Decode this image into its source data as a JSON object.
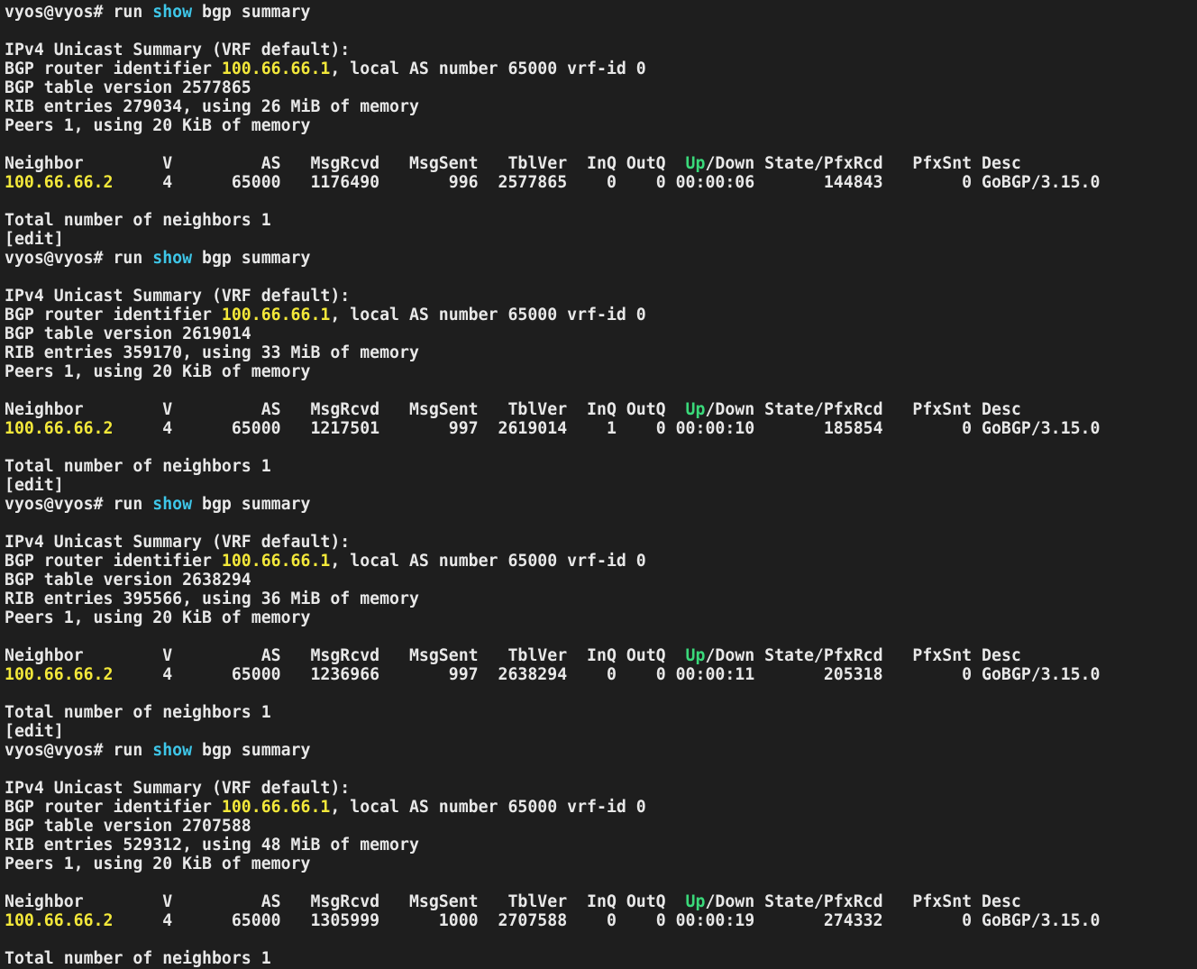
{
  "theme": {
    "background": "#1e1e1e",
    "foreground": "#e8e8e8",
    "command_keyword": "#3ec6e8",
    "ip_address": "#f3e83a",
    "up_status": "#3ad97a"
  },
  "lines": [
    [
      {
        "t": "vyos@vyos# run "
      },
      {
        "t": "show",
        "c": "show"
      },
      {
        "t": " bgp summary"
      }
    ],
    [],
    [
      {
        "t": "IPv4 Unicast Summary (VRF default):"
      }
    ],
    [
      {
        "t": "BGP router identifier "
      },
      {
        "t": "100.66.66.1",
        "c": "ip"
      },
      {
        "t": ", local AS number 65000 vrf-id 0"
      }
    ],
    [
      {
        "t": "BGP table version 2577865"
      }
    ],
    [
      {
        "t": "RIB entries 279034, using 26 MiB of memory"
      }
    ],
    [
      {
        "t": "Peers 1, using 20 KiB of memory"
      }
    ],
    [],
    [
      {
        "t": "Neighbor        V         AS   MsgRcvd   MsgSent   TblVer  InQ OutQ  "
      },
      {
        "t": "Up",
        "c": "up"
      },
      {
        "t": "/Down State/PfxRcd   PfxSnt Desc"
      }
    ],
    [
      {
        "t": "100.66.66.2",
        "c": "ip"
      },
      {
        "t": "     4      65000   1176490       996  2577865    0    0 00:00:06       144843        0 GoBGP/3.15.0"
      }
    ],
    [],
    [
      {
        "t": "Total number of neighbors 1"
      }
    ],
    [
      {
        "t": "[edit]"
      }
    ],
    [
      {
        "t": "vyos@vyos# run "
      },
      {
        "t": "show",
        "c": "show"
      },
      {
        "t": " bgp summary"
      }
    ],
    [],
    [
      {
        "t": "IPv4 Unicast Summary (VRF default):"
      }
    ],
    [
      {
        "t": "BGP router identifier "
      },
      {
        "t": "100.66.66.1",
        "c": "ip"
      },
      {
        "t": ", local AS number 65000 vrf-id 0"
      }
    ],
    [
      {
        "t": "BGP table version 2619014"
      }
    ],
    [
      {
        "t": "RIB entries 359170, using 33 MiB of memory"
      }
    ],
    [
      {
        "t": "Peers 1, using 20 KiB of memory"
      }
    ],
    [],
    [
      {
        "t": "Neighbor        V         AS   MsgRcvd   MsgSent   TblVer  InQ OutQ  "
      },
      {
        "t": "Up",
        "c": "up"
      },
      {
        "t": "/Down State/PfxRcd   PfxSnt Desc"
      }
    ],
    [
      {
        "t": "100.66.66.2",
        "c": "ip"
      },
      {
        "t": "     4      65000   1217501       997  2619014    1    0 00:00:10       185854        0 GoBGP/3.15.0"
      }
    ],
    [],
    [
      {
        "t": "Total number of neighbors 1"
      }
    ],
    [
      {
        "t": "[edit]"
      }
    ],
    [
      {
        "t": "vyos@vyos# run "
      },
      {
        "t": "show",
        "c": "show"
      },
      {
        "t": " bgp summary"
      }
    ],
    [],
    [
      {
        "t": "IPv4 Unicast Summary (VRF default):"
      }
    ],
    [
      {
        "t": "BGP router identifier "
      },
      {
        "t": "100.66.66.1",
        "c": "ip"
      },
      {
        "t": ", local AS number 65000 vrf-id 0"
      }
    ],
    [
      {
        "t": "BGP table version 2638294"
      }
    ],
    [
      {
        "t": "RIB entries 395566, using 36 MiB of memory"
      }
    ],
    [
      {
        "t": "Peers 1, using 20 KiB of memory"
      }
    ],
    [],
    [
      {
        "t": "Neighbor        V         AS   MsgRcvd   MsgSent   TblVer  InQ OutQ  "
      },
      {
        "t": "Up",
        "c": "up"
      },
      {
        "t": "/Down State/PfxRcd   PfxSnt Desc"
      }
    ],
    [
      {
        "t": "100.66.66.2",
        "c": "ip"
      },
      {
        "t": "     4      65000   1236966       997  2638294    0    0 00:00:11       205318        0 GoBGP/3.15.0"
      }
    ],
    [],
    [
      {
        "t": "Total number of neighbors 1"
      }
    ],
    [
      {
        "t": "[edit]"
      }
    ],
    [
      {
        "t": "vyos@vyos# run "
      },
      {
        "t": "show",
        "c": "show"
      },
      {
        "t": " bgp summary"
      }
    ],
    [],
    [
      {
        "t": "IPv4 Unicast Summary (VRF default):"
      }
    ],
    [
      {
        "t": "BGP router identifier "
      },
      {
        "t": "100.66.66.1",
        "c": "ip"
      },
      {
        "t": ", local AS number 65000 vrf-id 0"
      }
    ],
    [
      {
        "t": "BGP table version 2707588"
      }
    ],
    [
      {
        "t": "RIB entries 529312, using 48 MiB of memory"
      }
    ],
    [
      {
        "t": "Peers 1, using 20 KiB of memory"
      }
    ],
    [],
    [
      {
        "t": "Neighbor        V         AS   MsgRcvd   MsgSent   TblVer  InQ OutQ  "
      },
      {
        "t": "Up",
        "c": "up"
      },
      {
        "t": "/Down State/PfxRcd   PfxSnt Desc"
      }
    ],
    [
      {
        "t": "100.66.66.2",
        "c": "ip"
      },
      {
        "t": "     4      65000   1305999      1000  2707588    0    0 00:00:19       274332        0 GoBGP/3.15.0"
      }
    ],
    [],
    [
      {
        "t": "Total number of neighbors 1"
      }
    ]
  ]
}
